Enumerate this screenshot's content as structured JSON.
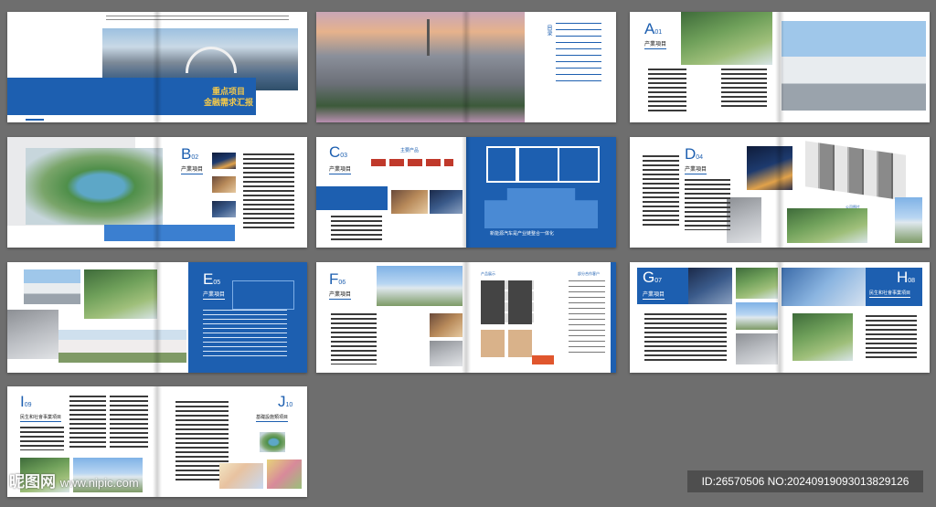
{
  "spreads": {
    "cover": {
      "title_line1": "重点项目",
      "title_line2": "金融需求汇报"
    },
    "toc": {
      "label": "目录"
    },
    "a": {
      "letter": "A",
      "num": "01",
      "title": "产業項目"
    },
    "b": {
      "letter": "B",
      "num": "02",
      "title": "产業項目"
    },
    "c": {
      "letter": "C",
      "num": "03",
      "title": "产業項目",
      "heading": "主要产品",
      "banner": "新能源汽车是产业链整合一体化"
    },
    "d": {
      "letter": "D",
      "num": "04",
      "title": "产業項目",
      "caption": "公司图片"
    },
    "e": {
      "letter": "E",
      "num": "05",
      "title": "产業項目"
    },
    "f": {
      "letter": "F",
      "num": "06",
      "title": "产業項目",
      "left_heading": "产品展示",
      "right_heading": "部分合作客户"
    },
    "g": {
      "letter": "G",
      "num": "07",
      "title": "产業項目"
    },
    "h": {
      "letter": "H",
      "num": "08",
      "title": "民生和社會事業項目"
    },
    "i": {
      "letter": "I",
      "num": "09",
      "title": "民生和社會事業項目"
    },
    "j": {
      "letter": "J",
      "num": "10",
      "title": "基礎設施類項目"
    }
  },
  "watermark": {
    "brand": "昵图网",
    "site": "www.nipic.com"
  },
  "image_id": "ID:26570506 NO:20240919093013829126"
}
